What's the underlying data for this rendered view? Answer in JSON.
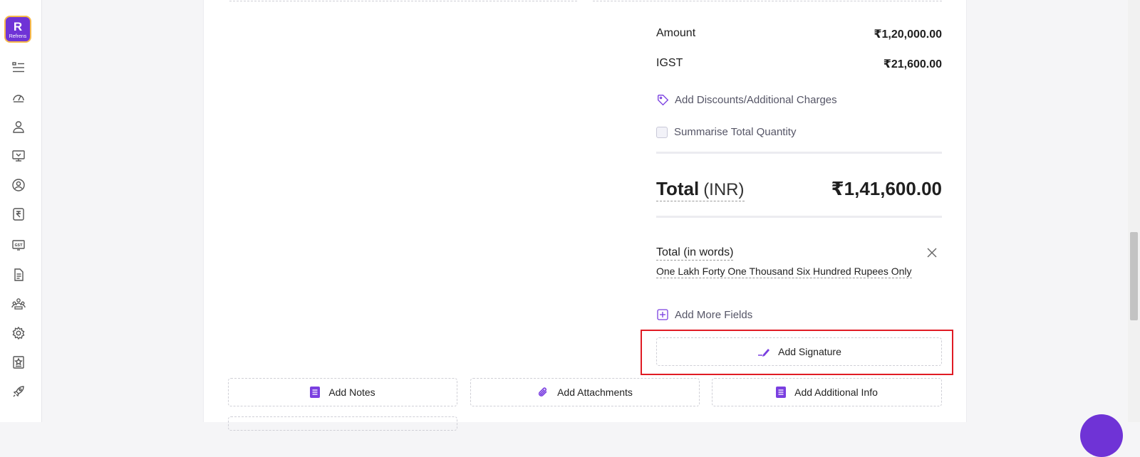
{
  "app": {
    "logo_mark": "R",
    "logo_text": "Refrens"
  },
  "sidebar": {
    "icons": [
      "list-icon",
      "dashboard-icon",
      "user-icon",
      "monitor-icon",
      "profile-icon",
      "rupee-icon",
      "gst-icon",
      "document-icon",
      "team-icon",
      "settings-icon",
      "star-doc-icon",
      "rocket-icon"
    ]
  },
  "summary": {
    "amount_label": "Amount",
    "amount_value": "₹1,20,000.00",
    "igst_label": "IGST",
    "igst_value": "₹21,600.00",
    "discounts_link": "Add Discounts/Additional Charges",
    "summarise_label": "Summarise Total Quantity",
    "total_label": "Total",
    "total_currency": "(INR)",
    "total_value": "₹1,41,600.00",
    "words_label": "Total (in words)",
    "words_text": "One Lakh Forty One Thousand Six Hundred Rupees Only",
    "add_more_fields": "Add More Fields",
    "add_signature": "Add Signature"
  },
  "bottom_actions": {
    "notes": "Add Notes",
    "attachments": "Add Attachments",
    "additional_info": "Add Additional Info"
  },
  "colors": {
    "accent": "#6f33d6",
    "highlight": "#e01b24"
  }
}
